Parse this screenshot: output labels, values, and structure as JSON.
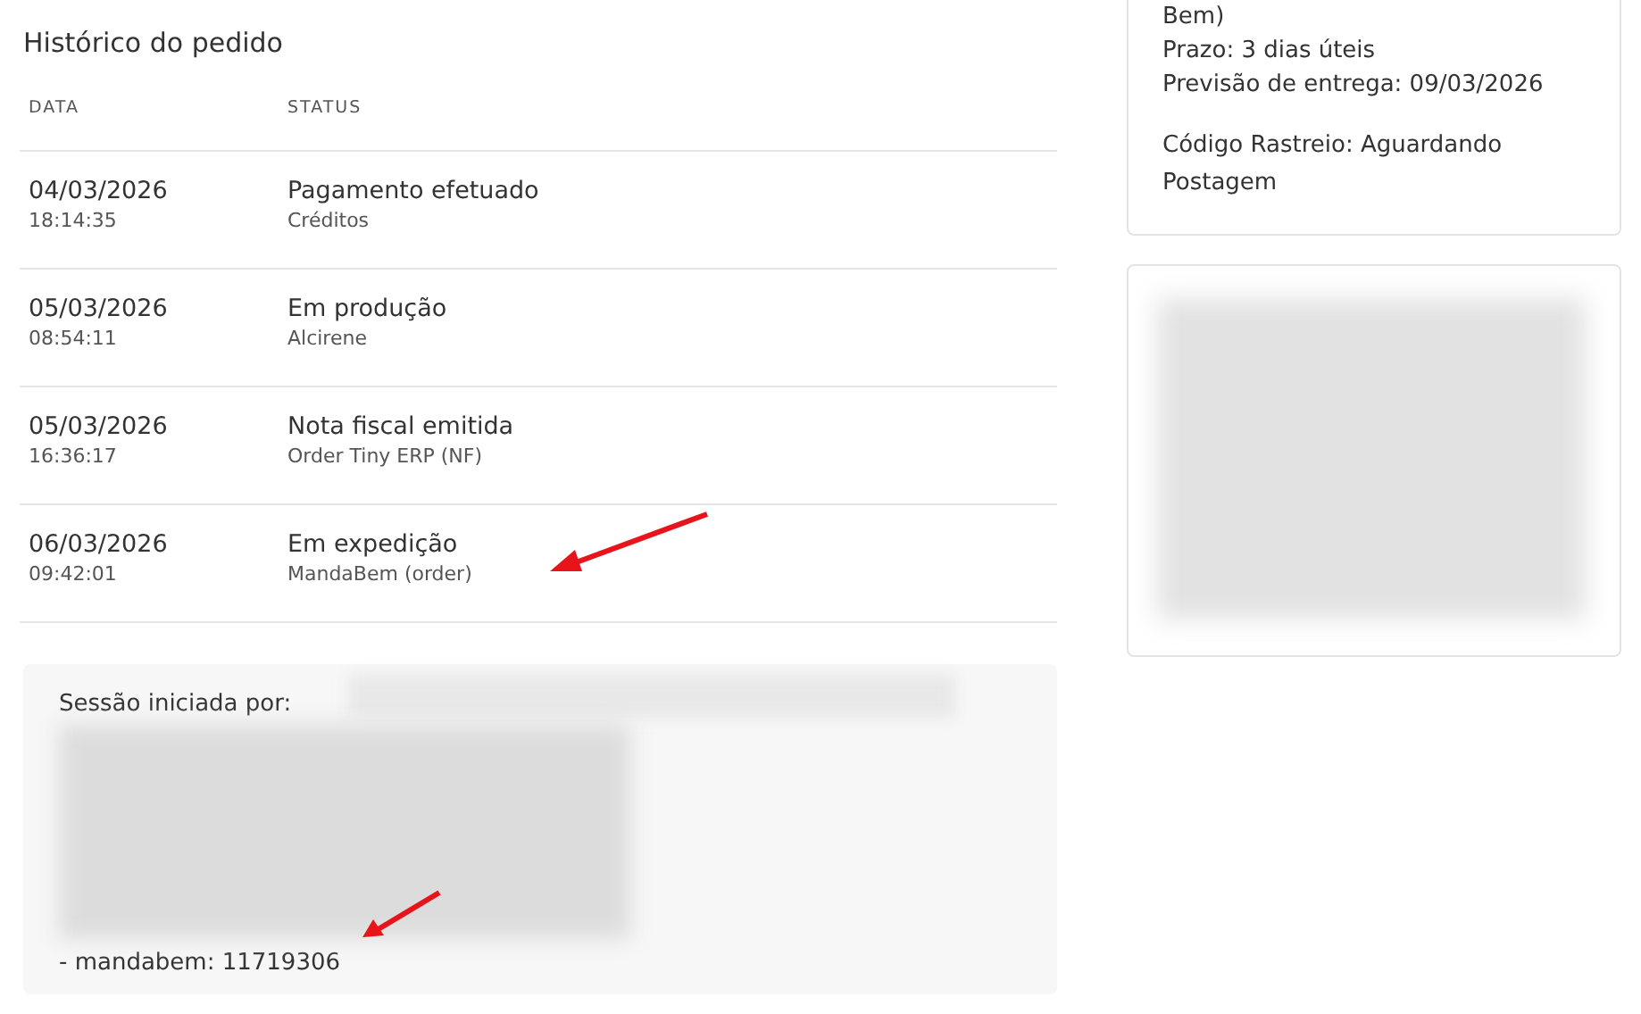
{
  "order_history": {
    "title": "Histórico do pedido",
    "columns": [
      "DATA",
      "STATUS"
    ],
    "rows": [
      {
        "date": "04/03/2026",
        "time": "18:14:35",
        "status": "Pagamento efetuado",
        "source": "Créditos"
      },
      {
        "date": "05/03/2026",
        "time": "08:54:11",
        "status": "Em produção",
        "source": "Alcirene"
      },
      {
        "date": "05/03/2026",
        "time": "16:36:17",
        "status": "Nota fiscal emitida",
        "source": "Order Tiny ERP (NF)"
      },
      {
        "date": "06/03/2026",
        "time": "09:42:01",
        "status": "Em expedição",
        "source": "MandaBem (order)"
      }
    ]
  },
  "session": {
    "label": "Sessão iniciada por:",
    "line": "- mandabem: 11719306"
  },
  "shipping_card": {
    "lines": [
      "Bem)",
      "Prazo: 3 dias úteis",
      "Previsão de entrega: 09/03/2026"
    ],
    "tracking": "Código Rastreio: Aguardando Postagem"
  }
}
